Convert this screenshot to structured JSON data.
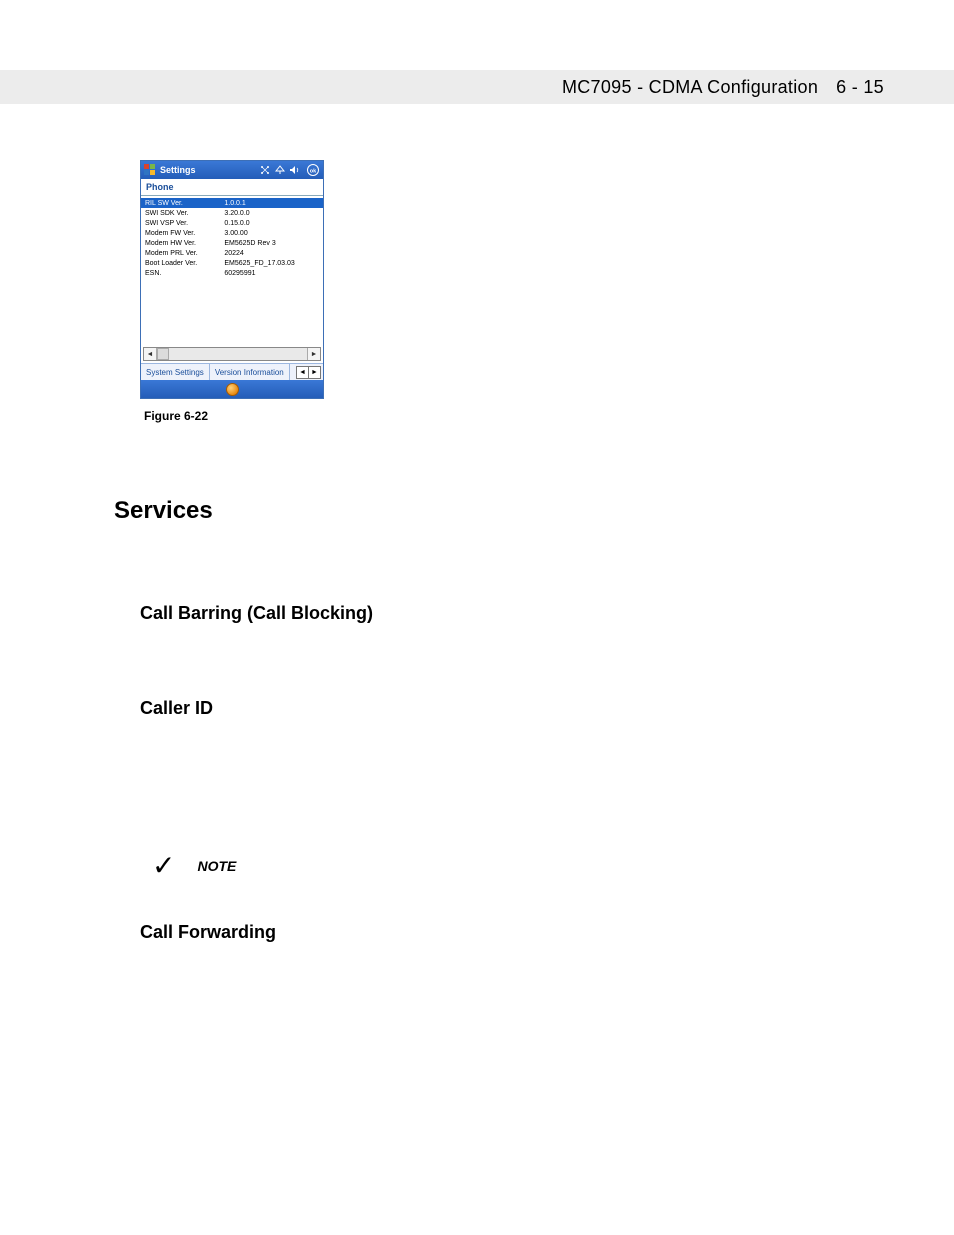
{
  "header": {
    "title": "MC7095 - CDMA Configuration",
    "page": "6 - 15"
  },
  "device": {
    "title": "Settings",
    "subtitle": "Phone",
    "rows": [
      {
        "label": "RIL SW Ver.",
        "value": "1.0.0.1",
        "selected": true
      },
      {
        "label": "SWI SDK Ver.",
        "value": "3.20.0.0"
      },
      {
        "label": "SWI VSP Ver.",
        "value": "0.15.0.0"
      },
      {
        "label": "Modem FW Ver.",
        "value": "3.00.00"
      },
      {
        "label": "Modem HW Ver.",
        "value": "EM5625D Rev 3"
      },
      {
        "label": "Modem PRL Ver.",
        "value": "20224"
      },
      {
        "label": "Boot Loader Ver.",
        "value": "EM5625_FD_17.03.03"
      },
      {
        "label": "ESN.",
        "value": "60295991"
      }
    ],
    "tabs": {
      "t1": "System Settings",
      "t2": "Version Information"
    }
  },
  "figure_caption": "Figure 6-22",
  "sections": {
    "services": "Services",
    "call_barring": "Call Barring (Call Blocking)",
    "caller_id": "Caller ID",
    "note_label": "NOTE",
    "call_forwarding": "Call Forwarding"
  }
}
